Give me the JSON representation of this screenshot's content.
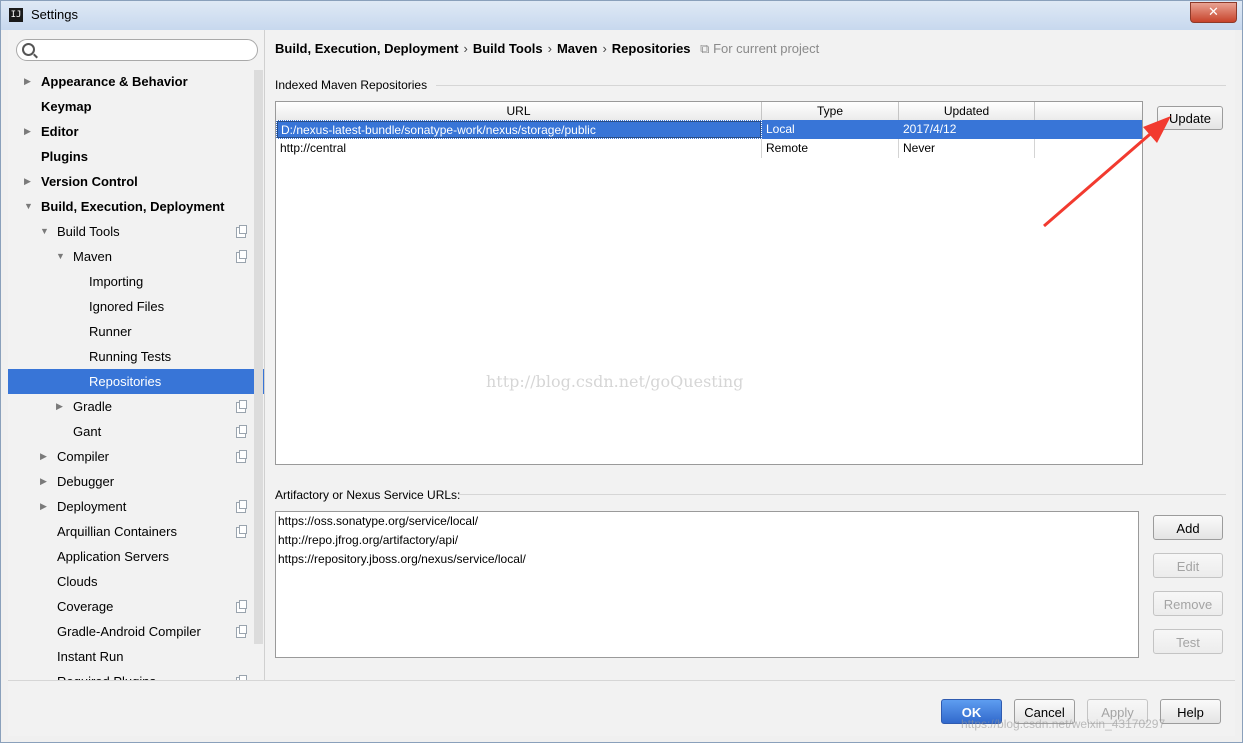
{
  "window": {
    "title": "Settings",
    "app_icon": "IJ",
    "close_glyph": "✕"
  },
  "search": {
    "placeholder": "",
    "value": ""
  },
  "sidebar": {
    "items": [
      {
        "label": "Appearance & Behavior",
        "bold": true,
        "level": 0,
        "arrow": "right",
        "project": false
      },
      {
        "label": "Keymap",
        "bold": true,
        "level": 0,
        "arrow": "none",
        "project": false
      },
      {
        "label": "Editor",
        "bold": true,
        "level": 0,
        "arrow": "right",
        "project": false
      },
      {
        "label": "Plugins",
        "bold": true,
        "level": 0,
        "arrow": "none",
        "project": false
      },
      {
        "label": "Version Control",
        "bold": true,
        "level": 0,
        "arrow": "right",
        "project": false
      },
      {
        "label": "Build, Execution, Deployment",
        "bold": true,
        "level": 0,
        "arrow": "down",
        "project": false
      },
      {
        "label": "Build Tools",
        "bold": false,
        "level": 1,
        "arrow": "down",
        "project": true
      },
      {
        "label": "Maven",
        "bold": false,
        "level": 2,
        "arrow": "down",
        "project": true
      },
      {
        "label": "Importing",
        "bold": false,
        "level": 3,
        "arrow": "none",
        "project": false
      },
      {
        "label": "Ignored Files",
        "bold": false,
        "level": 3,
        "arrow": "none",
        "project": false
      },
      {
        "label": "Runner",
        "bold": false,
        "level": 3,
        "arrow": "none",
        "project": false
      },
      {
        "label": "Running Tests",
        "bold": false,
        "level": 3,
        "arrow": "none",
        "project": false
      },
      {
        "label": "Repositories",
        "bold": false,
        "level": 3,
        "arrow": "none",
        "project": false,
        "selected": true
      },
      {
        "label": "Gradle",
        "bold": false,
        "level": 2,
        "arrow": "right",
        "project": true
      },
      {
        "label": "Gant",
        "bold": false,
        "level": 2,
        "arrow": "none",
        "project": true
      },
      {
        "label": "Compiler",
        "bold": false,
        "level": 1,
        "arrow": "right",
        "project": true
      },
      {
        "label": "Debugger",
        "bold": false,
        "level": 1,
        "arrow": "right",
        "project": false
      },
      {
        "label": "Deployment",
        "bold": false,
        "level": 1,
        "arrow": "right",
        "project": true
      },
      {
        "label": "Arquillian Containers",
        "bold": false,
        "level": 1,
        "arrow": "none",
        "project": true
      },
      {
        "label": "Application Servers",
        "bold": false,
        "level": 1,
        "arrow": "none",
        "project": false
      },
      {
        "label": "Clouds",
        "bold": false,
        "level": 1,
        "arrow": "none",
        "project": false
      },
      {
        "label": "Coverage",
        "bold": false,
        "level": 1,
        "arrow": "none",
        "project": true
      },
      {
        "label": "Gradle-Android Compiler",
        "bold": false,
        "level": 1,
        "arrow": "none",
        "project": true
      },
      {
        "label": "Instant Run",
        "bold": false,
        "level": 1,
        "arrow": "none",
        "project": false
      },
      {
        "label": "Required Plugins",
        "bold": false,
        "level": 1,
        "arrow": "none",
        "project": true
      }
    ]
  },
  "breadcrumb": {
    "items": [
      "Build, Execution, Deployment",
      "Build Tools",
      "Maven",
      "Repositories"
    ],
    "separator": "›",
    "project_note": "For current project"
  },
  "indexed": {
    "label": "Indexed Maven Repositories",
    "columns": [
      "URL",
      "Type",
      "Updated",
      ""
    ],
    "rows": [
      {
        "url": "D:/nexus-latest-bundle/sonatype-work/nexus/storage/public",
        "type": "Local",
        "updated": "2017/4/12",
        "selected": true
      },
      {
        "url": "http://central",
        "type": "Remote",
        "updated": "Never",
        "selected": false
      }
    ],
    "update_button": "Update"
  },
  "watermark": "http://blog.csdn.net/goQuesting",
  "service": {
    "label": "Artifactory or Nexus Service URLs:",
    "urls": [
      "https://oss.sonatype.org/service/local/",
      "http://repo.jfrog.org/artifactory/api/",
      "https://repository.jboss.org/nexus/service/local/"
    ],
    "buttons": {
      "add": "Add",
      "edit": "Edit",
      "remove": "Remove",
      "test": "Test"
    }
  },
  "footer": {
    "ok": "OK",
    "cancel": "Cancel",
    "apply": "Apply",
    "help": "Help",
    "watermark": "https://blog.csdn.net/weixin_43170297"
  },
  "colors": {
    "selection": "#3875d7",
    "annotation_arrow": "#f23a2f"
  }
}
